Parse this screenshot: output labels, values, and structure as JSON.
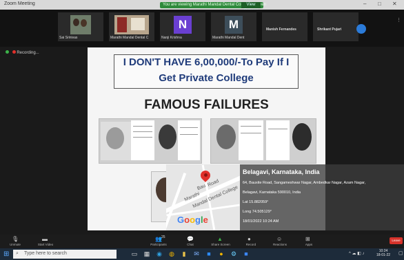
{
  "window": {
    "title": "Zoom Meeting",
    "banner_text": "You are viewing Marathi Mandal Dental College's screen",
    "banner_view": "View Options",
    "controls": [
      "–",
      "□",
      "✕"
    ]
  },
  "participants": [
    {
      "name": "Sai Srinivas",
      "type": "video"
    },
    {
      "name": "Marathi Mandal Dental C",
      "type": "video"
    },
    {
      "name": "Nanji Krishna",
      "type": "avatar",
      "initial": "N",
      "color": "#6a3fd1"
    },
    {
      "name": "Marathi Mandal Dent",
      "type": "avatar",
      "initial": "M",
      "color": "#3d4e5a"
    },
    {
      "name": "Manish Fernandes",
      "type": "text"
    },
    {
      "name": "Shrikant Pujari",
      "type": "text"
    }
  ],
  "strip_text": {
    "name1": "Marathi Mandal Dental C",
    "name2": "Sai Srinivas"
  },
  "recording": "Recording...",
  "slide": {
    "headline_line1": "I DON'T HAVE 6,00,000/-To Pay If I",
    "headline_line2": "Get Private College",
    "subheading": "FAMOUS FAILURES"
  },
  "map": {
    "brand": "Google",
    "labels": [
      "Road",
      "Bau",
      "Marathi",
      "Mandal Dental College"
    ]
  },
  "geotag": {
    "city": "Belagavi, Karnataka, India",
    "address": "64, Bauxite Road, Sangameshwar Nagar, Ambedkar Nagar, Azam Nagar,",
    "address2": "Belagavi, Karnataka 590010, India",
    "lat": "Lat 15.882059°",
    "long": "Long 74.505129°",
    "datetime": "18/01/2022 10:24 AM"
  },
  "toolbar": {
    "items": [
      {
        "label": "Unmute",
        "icon": "microphone-icon"
      },
      {
        "label": "Start Video",
        "icon": "video-camera-icon"
      },
      {
        "label": "Participants",
        "icon": "people-icon"
      },
      {
        "label": "Chat",
        "icon": "chat-icon"
      },
      {
        "label": "Share Screen",
        "icon": "share-screen-icon"
      },
      {
        "label": "Record",
        "icon": "record-icon"
      },
      {
        "label": "Reactions",
        "icon": "smile-icon"
      },
      {
        "label": "Apps",
        "icon": "apps-icon"
      }
    ],
    "participant_count": "25",
    "leave": "Leave"
  },
  "taskbar": {
    "search_placeholder": "Type here to search",
    "time": "10:24",
    "date": "18-01-22"
  },
  "colors": {
    "accent_green": "#2f8a3b",
    "leave_red": "#d7332b",
    "headline_blue": "#1f3b7a"
  }
}
